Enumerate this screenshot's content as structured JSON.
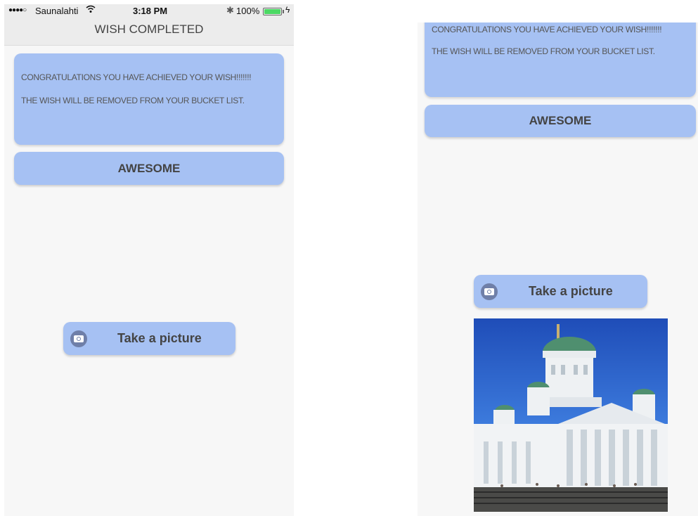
{
  "status_bar": {
    "signal": "●●●●○",
    "carrier": "Saunalahti",
    "wifi_icon": "wifi-icon",
    "time": "3:18 PM",
    "bluetooth_icon": "bluetooth-icon",
    "battery_text": "100%",
    "battery_level": 1.0,
    "charge_icon": "charging-bolt-icon"
  },
  "nav": {
    "title": "WISH COMPLETED"
  },
  "message": {
    "line1": "CONGRATULATIONS YOU HAVE ACHIEVED YOUR WISH!!!!!!!",
    "line2": "THE WISH WILL BE REMOVED FROM YOUR BUCKET LIST."
  },
  "buttons": {
    "awesome": "AWESOME",
    "take_picture": "Take a picture",
    "camera_icon": "camera-icon"
  },
  "photo": {
    "description_icon": "cathedral-photo"
  },
  "colors": {
    "card_blue": "#a6c1f3",
    "background": "#f7f7f7",
    "nav_bar": "#ececec",
    "battery_green": "#4cd964"
  }
}
